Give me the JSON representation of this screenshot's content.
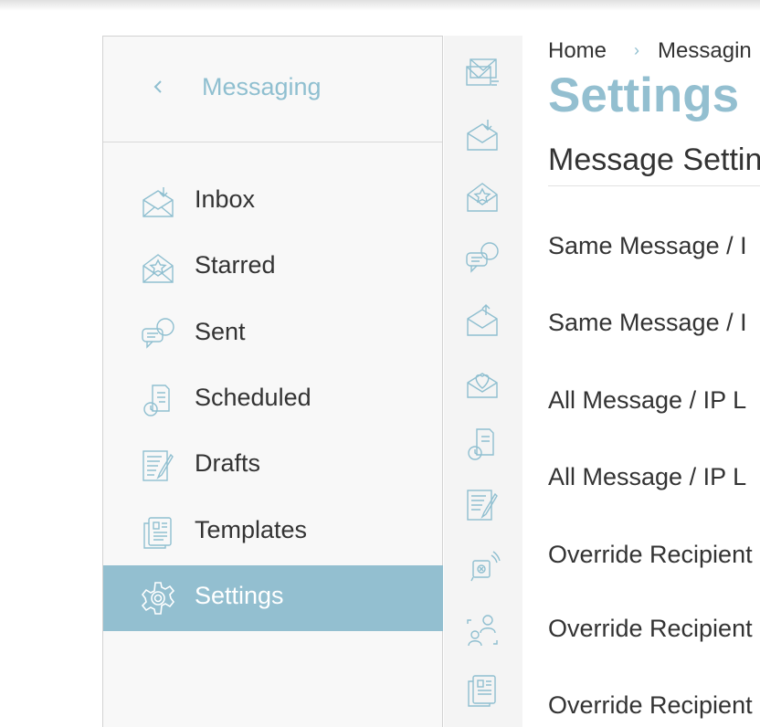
{
  "subnav": {
    "title": "Messaging",
    "items": [
      {
        "label": "Inbox",
        "icon": "inbox-icon"
      },
      {
        "label": "Starred",
        "icon": "starred-icon"
      },
      {
        "label": "Sent",
        "icon": "sent-icon"
      },
      {
        "label": "Scheduled",
        "icon": "scheduled-icon"
      },
      {
        "label": "Drafts",
        "icon": "drafts-icon"
      },
      {
        "label": "Templates",
        "icon": "templates-icon"
      },
      {
        "label": "Settings",
        "icon": "settings-icon",
        "active": true
      }
    ]
  },
  "rail": {
    "icons": [
      "compose-mail-icon",
      "inbox-icon",
      "starred-icon",
      "chat-bubbles-icon",
      "sent-mail-icon",
      "favorite-mail-icon",
      "scheduled-icon",
      "drafts-icon",
      "broadcast-icon",
      "contacts-icon",
      "templates-icon"
    ]
  },
  "breadcrumb": {
    "home": "Home",
    "current": "Messagin"
  },
  "page": {
    "title": "Settings",
    "section": "Message Settin"
  },
  "settings_rows": [
    "Same Message / I",
    "Same Message / I",
    "All Message / IP L",
    "All Message / IP L",
    "Override Recipient",
    "Override Recipient",
    "Override Recipient"
  ],
  "colors": {
    "accent": "#93bfd0",
    "active_bg": "#93bfd0",
    "text": "#333333",
    "panel_bg": "#f8f8f8",
    "rail_bg": "#f4f4f4"
  }
}
